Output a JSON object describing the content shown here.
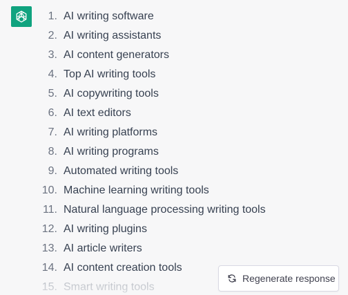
{
  "assistant": {
    "avatar_icon": "openai-logo-icon",
    "avatar_color": "#10a37f"
  },
  "response": {
    "items": [
      {
        "number": "1.",
        "text": "AI writing software"
      },
      {
        "number": "2.",
        "text": "AI writing assistants"
      },
      {
        "number": "3.",
        "text": "AI content generators"
      },
      {
        "number": "4.",
        "text": "Top AI writing tools"
      },
      {
        "number": "5.",
        "text": "AI copywriting tools"
      },
      {
        "number": "6.",
        "text": "AI text editors"
      },
      {
        "number": "7.",
        "text": "AI writing platforms"
      },
      {
        "number": "8.",
        "text": "AI writing programs"
      },
      {
        "number": "9.",
        "text": "Automated writing tools"
      },
      {
        "number": "10.",
        "text": "Machine learning writing tools"
      },
      {
        "number": "11.",
        "text": "Natural language processing writing tools"
      },
      {
        "number": "12.",
        "text": "AI writing plugins"
      },
      {
        "number": "13.",
        "text": "AI article writers"
      },
      {
        "number": "14.",
        "text": "AI content creation tools"
      },
      {
        "number": "15.",
        "text": "Smart writing tools"
      }
    ]
  },
  "controls": {
    "regenerate_label": "Regenerate response",
    "regenerate_icon": "refresh-icon"
  }
}
